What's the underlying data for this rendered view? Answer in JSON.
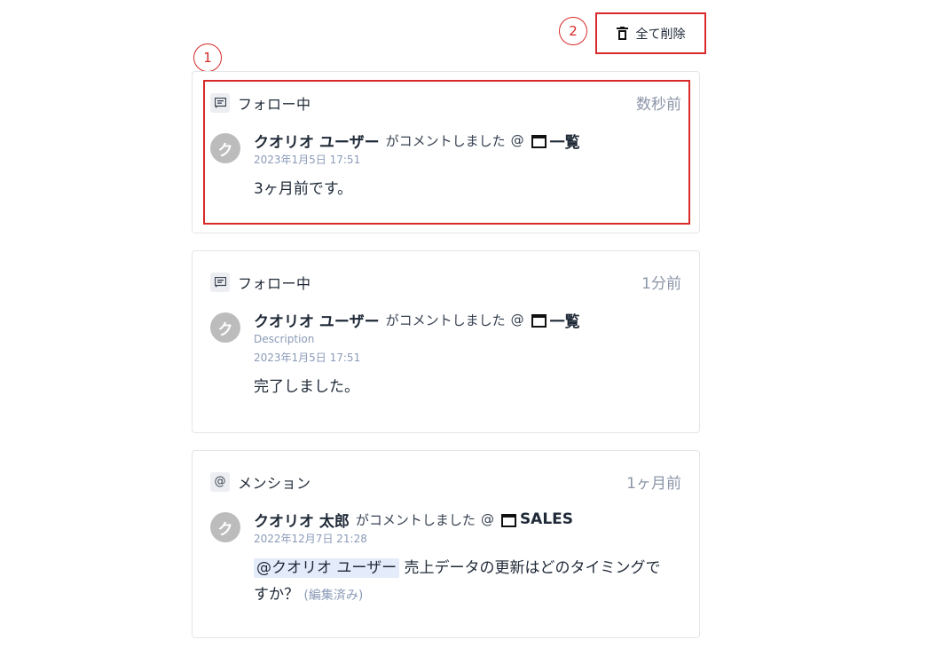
{
  "callouts": [
    "1",
    "2"
  ],
  "toolbar": {
    "delete_all_label": "全て削除"
  },
  "notifications": [
    {
      "type_label": "フォロー中",
      "type_icon": "comment-icon",
      "time": "数秒前",
      "avatar_initial": "ク",
      "user": "クオリオ ユーザー",
      "action": "がコメントしました",
      "at": "@",
      "board": "一覧",
      "meta": [
        "2023年1月5日 17:51"
      ],
      "message": "3ヶ月前です。"
    },
    {
      "type_label": "フォロー中",
      "type_icon": "comment-icon",
      "time": "1分前",
      "avatar_initial": "ク",
      "user": "クオリオ ユーザー",
      "action": "がコメントしました",
      "at": "@",
      "board": "一覧",
      "meta": [
        "Description",
        "2023年1月5日 17:51"
      ],
      "message": "完了しました。"
    },
    {
      "type_label": "メンション",
      "type_icon": "at-icon",
      "time": "1ヶ月前",
      "avatar_initial": "ク",
      "user": "クオリオ 太郎",
      "action": "がコメントしました",
      "at": "@",
      "board": "SALES",
      "meta": [
        "2022年12月7日 21:28"
      ],
      "mention": "@クオリオ ユーザー",
      "message": "売上データの更新はどのタイミングですか？",
      "edited": "(編集済み)"
    }
  ],
  "colors": {
    "highlight": "#d92a2a",
    "mention_bg": "#e4ebfa",
    "meta": "#8b9bb8"
  }
}
